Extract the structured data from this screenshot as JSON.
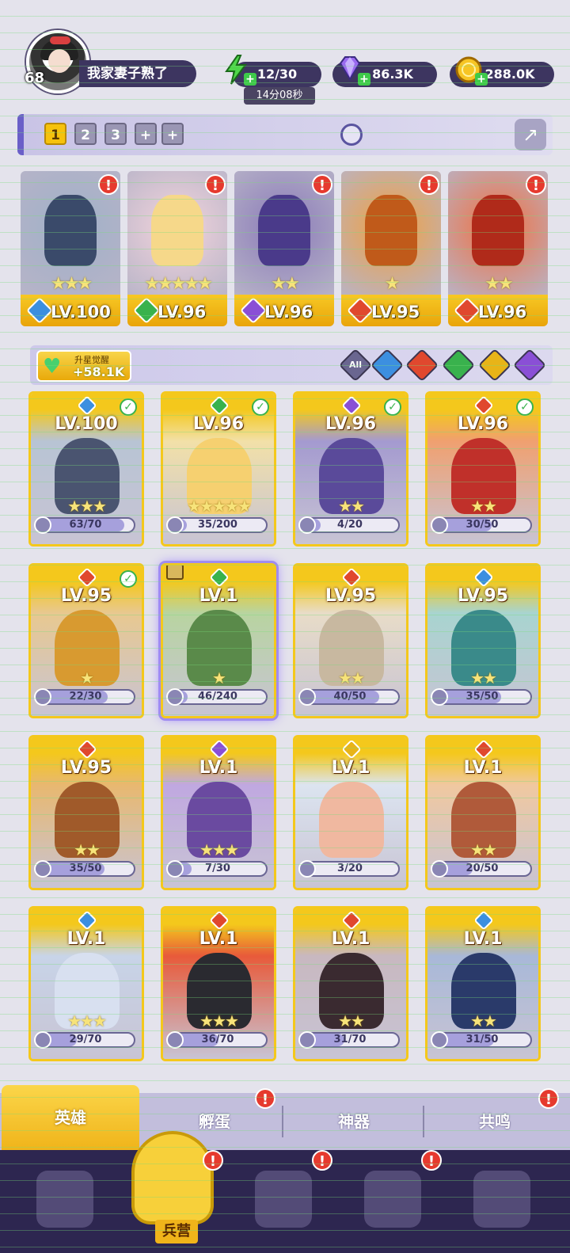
{
  "player": {
    "level": "68",
    "name": "我家妻子熟了"
  },
  "resources": {
    "energy": "12/30",
    "energy_timer": "14分08秒",
    "gems": "86.3K",
    "coins": "288.0K"
  },
  "team_slots": [
    "1",
    "2",
    "3",
    "+",
    "+"
  ],
  "team_heroes": [
    {
      "level": "LV.100",
      "stars": "★★★",
      "element": "water",
      "color": "#3c8fe0",
      "art": "#9fb0c8",
      "fig": "#3a4a6a"
    },
    {
      "level": "LV.96",
      "stars": "★★★★★",
      "element": "nature",
      "color": "#39b24d",
      "art": "#f3d4dc",
      "fig": "#f6d88a"
    },
    {
      "level": "LV.96",
      "stars": "★★",
      "element": "dark",
      "color": "#8a4fd6",
      "art": "#8a7ab8",
      "fig": "#4a3a8a"
    },
    {
      "level": "LV.95",
      "stars": "★",
      "element": "fire",
      "color": "#e0482e",
      "art": "#f0a040",
      "fig": "#c05a1a"
    },
    {
      "level": "LV.96",
      "stars": "★★",
      "element": "fire",
      "color": "#e0482e",
      "art": "#f07040",
      "fig": "#b02a1a"
    }
  ],
  "awaken": {
    "label": "升星觉醒",
    "value": "+58.1K"
  },
  "filters": [
    {
      "name": "all",
      "label": "All",
      "color": "#6a6690"
    },
    {
      "name": "water",
      "label": "",
      "color": "#3c8fe0"
    },
    {
      "name": "fire",
      "label": "",
      "color": "#e0482e"
    },
    {
      "name": "nature",
      "label": "",
      "color": "#39b24d"
    },
    {
      "name": "light",
      "label": "",
      "color": "#e8b418"
    },
    {
      "name": "dark",
      "label": "",
      "color": "#8a4fd6"
    }
  ],
  "heroes": [
    {
      "level": "LV.100",
      "stars": "★★★",
      "frag": "63/70",
      "progress": 0.9,
      "color": "#3c8fe0",
      "art": "#b8c4d4",
      "fig": "#4a5470",
      "check": true
    },
    {
      "level": "LV.96",
      "stars": "★★★★★",
      "frag": "35/200",
      "progress": 0.18,
      "color": "#39b24d",
      "art": "#f2e0a8",
      "fig": "#f6d070",
      "check": true
    },
    {
      "level": "LV.96",
      "stars": "★★",
      "frag": "4/20",
      "progress": 0.2,
      "color": "#8a4fd6",
      "art": "#a49ad0",
      "fig": "#5a4a9a",
      "check": true
    },
    {
      "level": "LV.96",
      "stars": "★★",
      "frag": "30/50",
      "progress": 0.6,
      "color": "#e0482e",
      "art": "#f0a070",
      "fig": "#c0302a",
      "check": true
    },
    {
      "level": "LV.95",
      "stars": "★",
      "frag": "22/30",
      "progress": 0.73,
      "color": "#e0482e",
      "art": "#e8c890",
      "fig": "#d89a30",
      "check": true
    },
    {
      "level": "LV.1",
      "stars": "★",
      "frag": "46/240",
      "progress": 0.19,
      "color": "#39b24d",
      "art": "#b8d4a0",
      "fig": "#5a8a4a",
      "check": false,
      "selected": true
    },
    {
      "level": "LV.95",
      "stars": "★★",
      "frag": "40/50",
      "progress": 0.8,
      "color": "#e0482e",
      "art": "#e8dcc8",
      "fig": "#c8b8a0",
      "check": false
    },
    {
      "level": "LV.95",
      "stars": "★★",
      "frag": "35/50",
      "progress": 0.7,
      "color": "#3c8fe0",
      "art": "#a8d4d0",
      "fig": "#3a8a8a",
      "check": false
    },
    {
      "level": "LV.95",
      "stars": "★★",
      "frag": "35/50",
      "progress": 0.7,
      "color": "#e0482e",
      "art": "#e8b870",
      "fig": "#a05a2a",
      "check": false
    },
    {
      "level": "LV.1",
      "stars": "★★★",
      "frag": "7/30",
      "progress": 0.23,
      "color": "#8a4fd6",
      "art": "#c0a8e0",
      "fig": "#6a4aa0",
      "check": false
    },
    {
      "level": "LV.1",
      "stars": "",
      "frag": "3/20",
      "progress": 0.15,
      "color": "#e8b418",
      "art": "#dce4f0",
      "fig": "#f0b8a0",
      "check": false
    },
    {
      "level": "LV.1",
      "stars": "★★",
      "frag": "20/50",
      "progress": 0.4,
      "color": "#e0482e",
      "art": "#f0c8a0",
      "fig": "#b05a3a",
      "check": false
    },
    {
      "level": "LV.1",
      "stars": "★★★",
      "frag": "29/70",
      "progress": 0.41,
      "color": "#3c8fe0",
      "art": "#c8d4e8",
      "fig": "#d8e0f0",
      "check": false
    },
    {
      "level": "LV.1",
      "stars": "★★★",
      "frag": "36/70",
      "progress": 0.51,
      "color": "#e0482e",
      "art": "#e85a3a",
      "fig": "#2a2a30",
      "check": false
    },
    {
      "level": "LV.1",
      "stars": "★★",
      "frag": "31/70",
      "progress": 0.44,
      "color": "#e0482e",
      "art": "#c8b8c0",
      "fig": "#3a2a30",
      "check": false
    },
    {
      "level": "LV.1",
      "stars": "★★",
      "frag": "31/50",
      "progress": 0.62,
      "color": "#3c8fe0",
      "art": "#a8b8d8",
      "fig": "#2a3a6a",
      "check": false
    }
  ],
  "subtabs": {
    "heroes": "英雄",
    "eggs": "孵蛋",
    "artifacts": "神器",
    "resonance": "共鸣"
  },
  "nav": {
    "barracks": "兵营"
  },
  "alert_symbol": "!",
  "check_symbol": "✓",
  "plus_symbol": "+"
}
